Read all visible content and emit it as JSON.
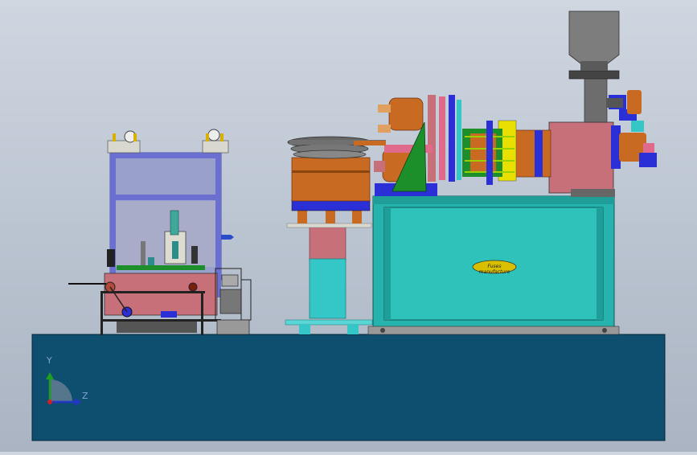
{
  "scene": {
    "view": "CAD assembly model, side elevation",
    "colors": {
      "background_top": "#cfd6e0",
      "background_bottom": "#aab4c2",
      "base_platform": "#0e4e6e",
      "machine_cabinet": "#26b3ad",
      "pink_housing": "#c8707a",
      "bronze_parts": "#c86a22",
      "frame_purple": "#6a6fd0",
      "hopper_grey": "#6d6d6d",
      "green_bracket": "#1d8f2a",
      "blue_parts": "#2b2fd6"
    }
  },
  "triad": {
    "y_label": "Y",
    "z_label": "Z",
    "icons": [
      "axis-y-arrow-icon",
      "axis-z-arrow-icon",
      "axis-x-origin-icon"
    ]
  },
  "nameplate": {
    "text": "Fuses manufacture"
  }
}
